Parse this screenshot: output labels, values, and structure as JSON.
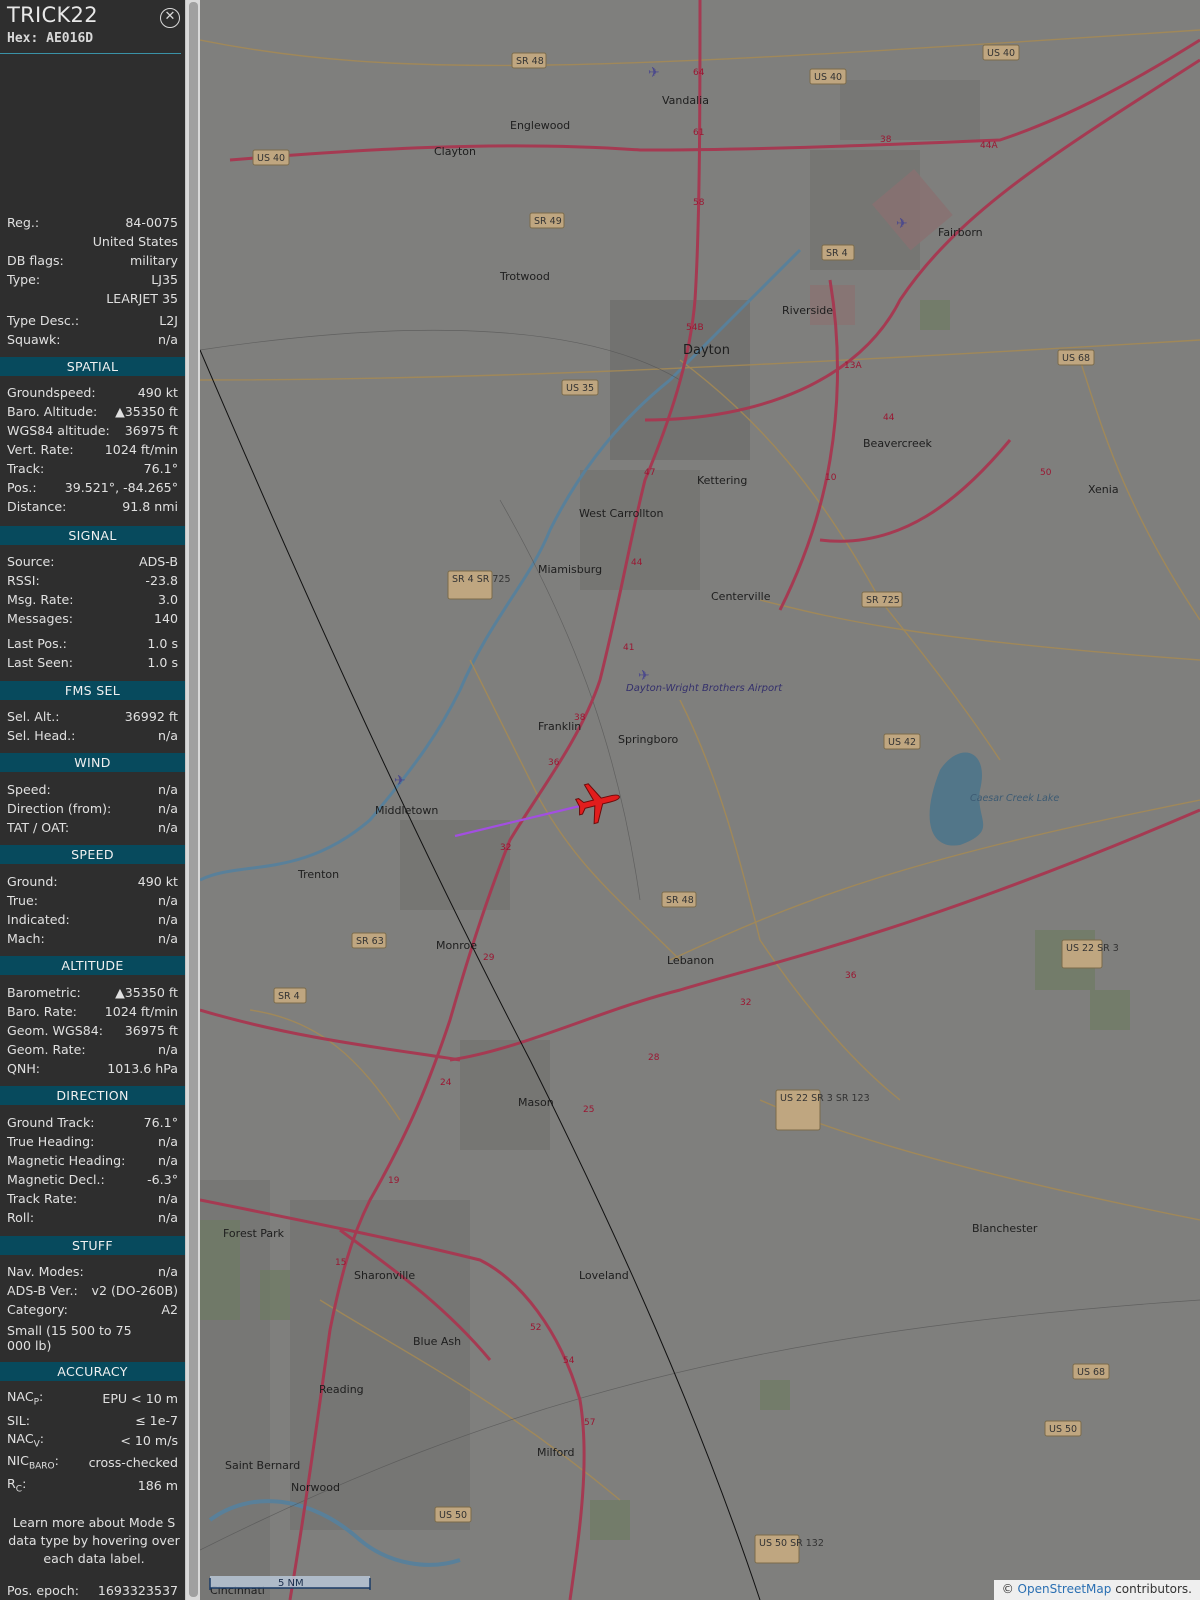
{
  "aircraft": {
    "callsign": "TRICK22",
    "hex_label": "Hex: AE016D",
    "close_symbol": "✕"
  },
  "info": [
    {
      "label": "Reg.:",
      "value": "84-0075"
    },
    {
      "label": "",
      "value": "United States"
    },
    {
      "label": "DB flags:",
      "value": "military"
    },
    {
      "label": "Type:",
      "value": "LJ35"
    },
    {
      "label": "",
      "value": "LEARJET 35"
    },
    {
      "label": "Type Desc.:",
      "value": "L2J"
    },
    {
      "label": "Squawk:",
      "value": "n/a"
    }
  ],
  "sections": {
    "spatial": {
      "title": "SPATIAL",
      "rows": [
        {
          "label": "Groundspeed:",
          "value": "490 kt"
        },
        {
          "label": "Baro. Altitude:",
          "value": "▲35350 ft"
        },
        {
          "label": "WGS84 altitude:",
          "value": "36975 ft"
        },
        {
          "label": "Vert. Rate:",
          "value": "1024 ft/min"
        },
        {
          "label": "Track:",
          "value": "76.1°"
        },
        {
          "label": "Pos.:",
          "value": "39.521°, -84.265°"
        },
        {
          "label": "Distance:",
          "value": "91.8 nmi"
        }
      ]
    },
    "signal": {
      "title": "SIGNAL",
      "rows": [
        {
          "label": "Source:",
          "value": "ADS-B"
        },
        {
          "label": "RSSI:",
          "value": "-23.8"
        },
        {
          "label": "Msg. Rate:",
          "value": "3.0"
        },
        {
          "label": "Messages:",
          "value": "140"
        },
        {
          "label": "Last Pos.:",
          "value": "1.0 s"
        },
        {
          "label": "Last Seen:",
          "value": "1.0 s"
        }
      ]
    },
    "fms": {
      "title": "FMS SEL",
      "rows": [
        {
          "label": "Sel. Alt.:",
          "value": "36992 ft"
        },
        {
          "label": "Sel. Head.:",
          "value": "n/a"
        }
      ]
    },
    "wind": {
      "title": "WIND",
      "rows": [
        {
          "label": "Speed:",
          "value": "n/a"
        },
        {
          "label": "Direction (from):",
          "value": "n/a"
        },
        {
          "label": "TAT / OAT:",
          "value": "n/a"
        }
      ]
    },
    "speed": {
      "title": "SPEED",
      "rows": [
        {
          "label": "Ground:",
          "value": "490 kt"
        },
        {
          "label": "True:",
          "value": "n/a"
        },
        {
          "label": "Indicated:",
          "value": "n/a"
        },
        {
          "label": "Mach:",
          "value": "n/a"
        }
      ]
    },
    "altitude": {
      "title": "ALTITUDE",
      "rows": [
        {
          "label": "Barometric:",
          "value": "▲35350 ft"
        },
        {
          "label": "Baro. Rate:",
          "value": "1024 ft/min"
        },
        {
          "label": "Geom. WGS84:",
          "value": "36975 ft"
        },
        {
          "label": "Geom. Rate:",
          "value": "n/a"
        },
        {
          "label": "QNH:",
          "value": "1013.6 hPa"
        }
      ]
    },
    "direction": {
      "title": "DIRECTION",
      "rows": [
        {
          "label": "Ground Track:",
          "value": "76.1°"
        },
        {
          "label": "True Heading:",
          "value": "n/a"
        },
        {
          "label": "Magnetic Heading:",
          "value": "n/a"
        },
        {
          "label": "Magnetic Decl.:",
          "value": "-6.3°"
        },
        {
          "label": "Track Rate:",
          "value": "n/a"
        },
        {
          "label": "Roll:",
          "value": "n/a"
        }
      ]
    },
    "stuff": {
      "title": "STUFF",
      "rows": [
        {
          "label": "Nav. Modes:",
          "value": "n/a"
        },
        {
          "label": "ADS-B Ver.:",
          "value": "v2 (DO-260B)"
        },
        {
          "label": "Category:",
          "value": "A2"
        }
      ],
      "category_text": "Small (15 500 to 75 000 lb)"
    },
    "accuracy": {
      "title": "ACCURACY",
      "nacp_main": "NAC",
      "nacp_sub": "P",
      "nacp_value": "EPU < 10 m",
      "sil_label": "SIL:",
      "sil_value": "≤ 1e-7",
      "nacv_main": "NAC",
      "nacv_sub": "V",
      "nacv_value": "< 10 m/s",
      "nicbaro_main": "NIC",
      "nicbaro_sub": "BARO",
      "nicbaro_value": "cross-checked",
      "rc_main": "R",
      "rc_sub": "C",
      "rc_value": "186 m"
    }
  },
  "learn_more": "Learn more about Mode S data type by hovering over each data label.",
  "pos_epoch": {
    "label": "Pos. epoch:",
    "value": "1693323537"
  },
  "map": {
    "towns": [
      "Vandalia",
      "Englewood",
      "Clayton",
      "Trotwood",
      "Riverside",
      "Fairborn",
      "Dayton",
      "Beavercreek",
      "Kettering",
      "Xenia",
      "West Carrollton",
      "Miamisburg",
      "Centerville",
      "Franklin",
      "Springboro",
      "Middletown",
      "Trenton",
      "Monroe",
      "Lebanon",
      "Mason",
      "Forest Park",
      "Sharonville",
      "Loveland",
      "Blanchester",
      "Blue Ash",
      "Reading",
      "Saint Bernard",
      "Norwood",
      "Milford",
      "Cincinnati"
    ],
    "shields": [
      "SR 48",
      "US 40",
      "US 40",
      "US 40",
      "SR 49",
      "SR 4",
      "US 35",
      "US 68",
      "SR 4 SR 725",
      "SR 725",
      "US 42",
      "SR 48",
      "SR 63",
      "SR 4",
      "US 22 SR 3",
      "US 22 SR 3 SR 123",
      "US 68",
      "US 50",
      "US 50",
      "US 50 SR 132"
    ],
    "airport_name": "Dayton-Wright Brothers Airport",
    "lake_name": "Caesar Creek Lake",
    "scale_label": "5 NM",
    "attribution_prefix": "© ",
    "attribution_link": "OpenStreetMap",
    "attribution_suffix": " contributors."
  },
  "colors": {
    "sidebar_bg": "#2e2e2e",
    "section_header_bg": "#074a5d",
    "map_tint": "#7f7f7d",
    "motorway": "#a53a52",
    "aircraft": "#e21d1d",
    "track_trail": "#a24fe0"
  }
}
